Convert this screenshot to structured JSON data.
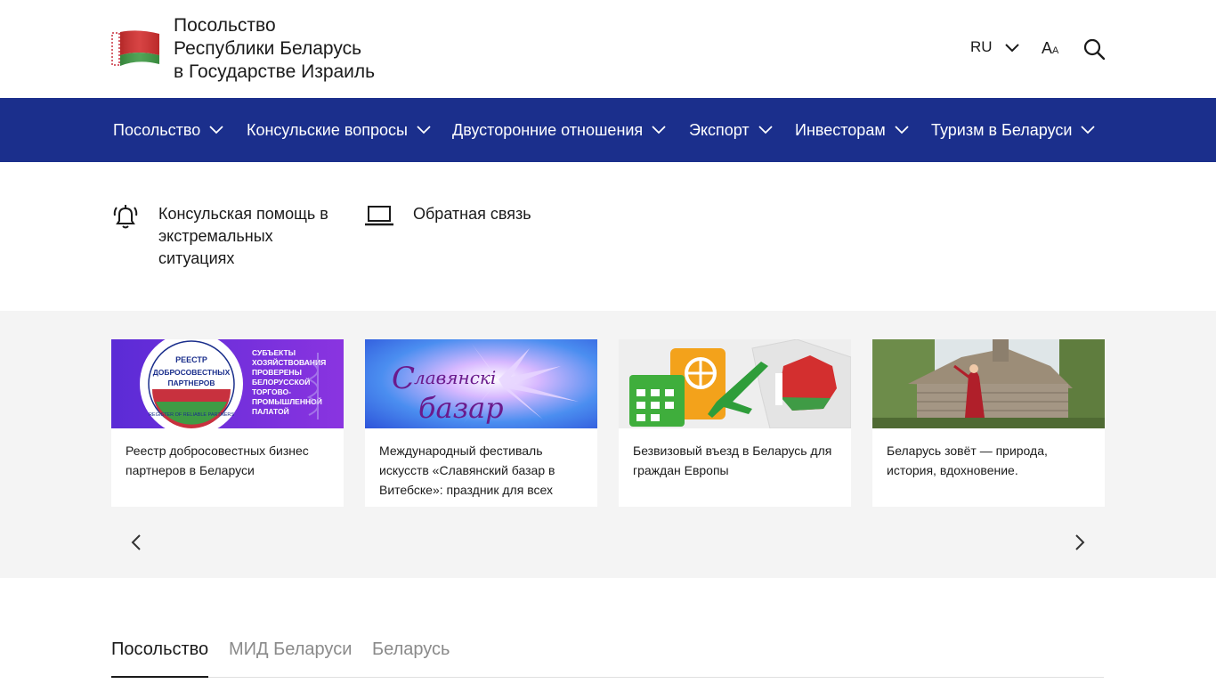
{
  "header": {
    "title_lines": [
      "Посольство",
      "Республики Беларусь",
      "в Государстве Израиль"
    ],
    "lang": "RU",
    "font_big": "A",
    "font_small": "A"
  },
  "nav": {
    "items": [
      {
        "label": "Посольство"
      },
      {
        "label": "Консульские вопросы"
      },
      {
        "label": "Двусторонние отношения"
      },
      {
        "label": "Экспорт"
      },
      {
        "label": "Инвесторам"
      },
      {
        "label": "Туризм в Беларуси"
      }
    ]
  },
  "quick_links": [
    {
      "label": "Консульская помощь в экстремальных ситуациях",
      "icon": "alarm-bell-icon"
    },
    {
      "label": "Обратная связь",
      "icon": "laptop-icon"
    }
  ],
  "carousel": {
    "cards": [
      {
        "title": "Реестр добросовестных бизнес партнеров в Беларуси",
        "img_text": {
          "circle_top": "РЕЕСТР",
          "circle_mid1": "ДОБРОСОВЕСТНЫХ",
          "circle_mid2": "ПАРТНЕРОВ",
          "circle_ring": "REGISTER OF RELIABLE PARTNERS",
          "side_lines": [
            "СУБЪЕКТЫ",
            "ХОЗЯЙСТВОВАНИЯ",
            "ПРОВЕРЕНЫ",
            "БЕЛОРУССКОЙ",
            "ТОРГОВО-",
            "ПРОМЫШЛЕННОЙ",
            "ПАЛАТОЙ"
          ]
        }
      },
      {
        "title": "Международный фестиваль искусств «Славянский базар в Витебске»: праздник для всех",
        "img_text": {
          "line1": "лавянскi",
          "line2": "базар"
        }
      },
      {
        "title": "Безвизовый въезд в Беларусь для граждан Европы"
      },
      {
        "title": "Беларусь зовёт — природа, история, вдохновение."
      }
    ]
  },
  "tabs": [
    {
      "label": "Посольство"
    },
    {
      "label": "МИД Беларуси"
    },
    {
      "label": "Беларусь"
    }
  ],
  "colors": {
    "nav_bg": "#1b2f8c",
    "carousel_bg": "#f4f4f4",
    "flag_red": "#c8313e",
    "flag_green": "#4aa657"
  }
}
